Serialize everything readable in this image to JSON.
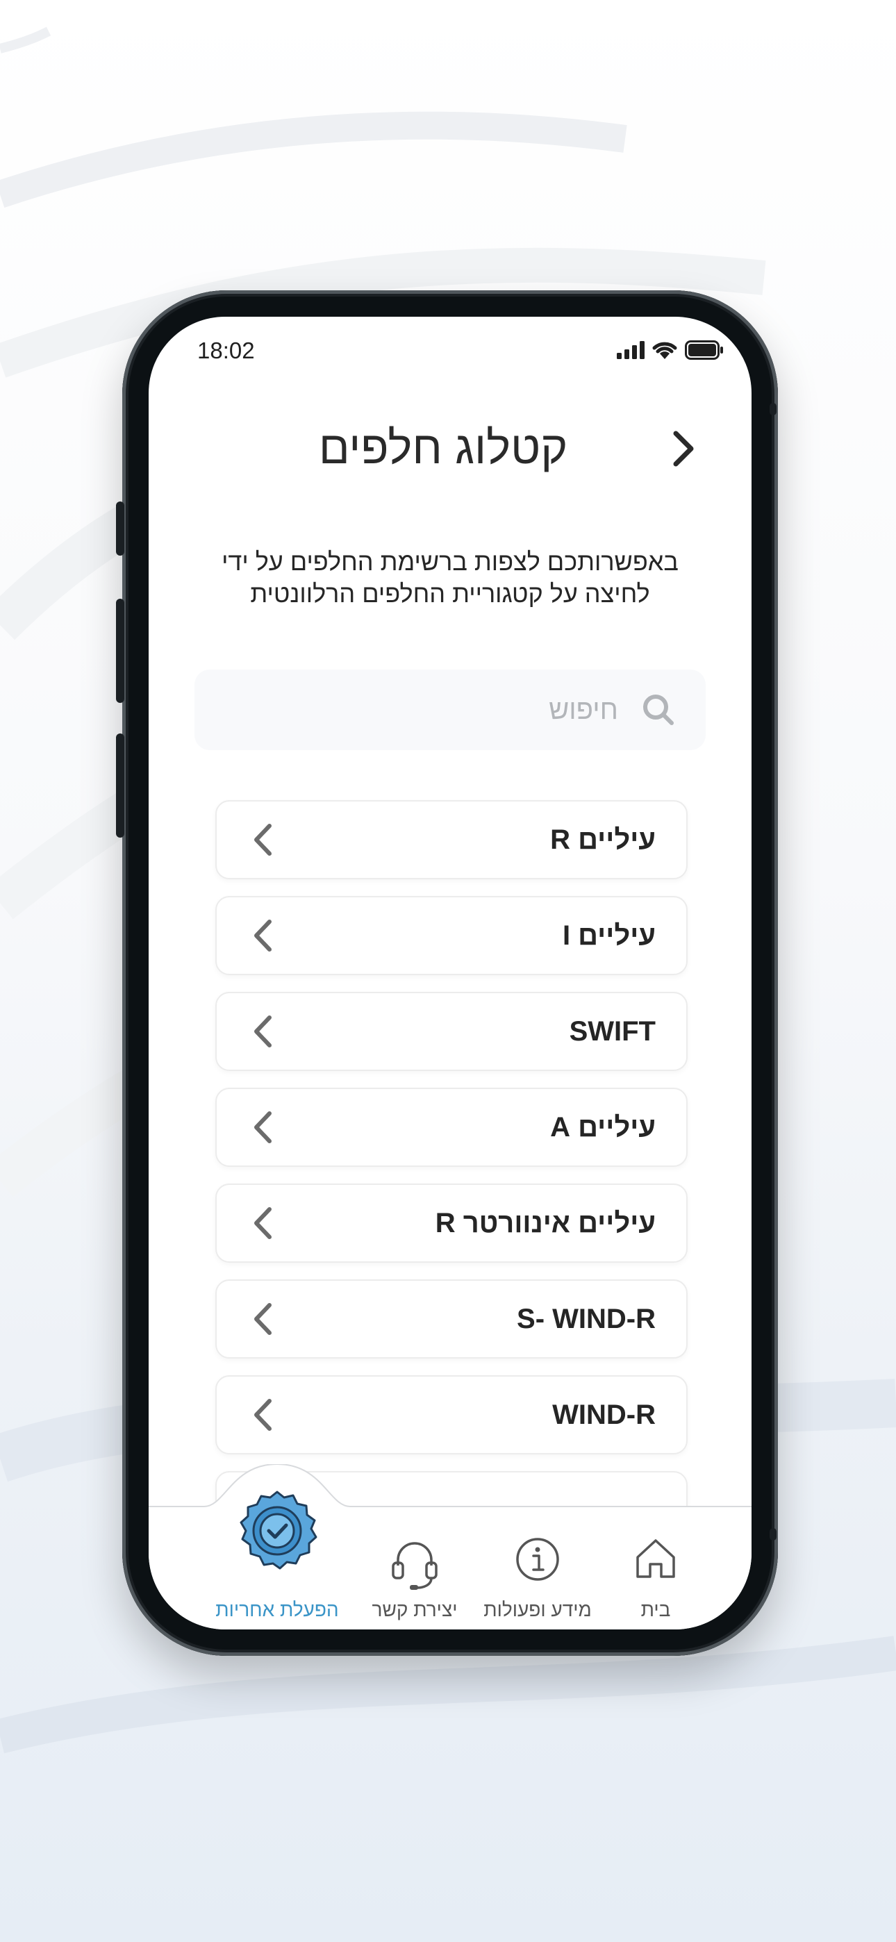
{
  "status_bar": {
    "time": "18:02"
  },
  "header": {
    "title": "קטלוג חלפים"
  },
  "intro": {
    "line1": "באפשרותכם לצפות ברשימת החלפים על ידי",
    "line2": "לחיצה על קטגוריית החלפים הרלוונטית"
  },
  "search": {
    "placeholder": "חיפוש",
    "value": ""
  },
  "categories": [
    "עיליים R",
    "עיליים I",
    "SWIFT",
    "עיליים A",
    "עיליים אינוורטר R",
    "S- WIND-R",
    "WIND-R"
  ],
  "bottom_nav": {
    "items": [
      {
        "label": "בית",
        "icon": "home-icon"
      },
      {
        "label": "מידע ופעולות",
        "icon": "info-icon"
      },
      {
        "label": "יצירת קשר",
        "icon": "headset-icon"
      },
      {
        "label": "הפעלת אחריות",
        "icon": "warranty-badge-icon"
      }
    ],
    "active": "הפעלת אחריות"
  },
  "colors": {
    "accent": "#3a94c7",
    "badge_fill": "#5aa6dc",
    "text": "#252525"
  }
}
